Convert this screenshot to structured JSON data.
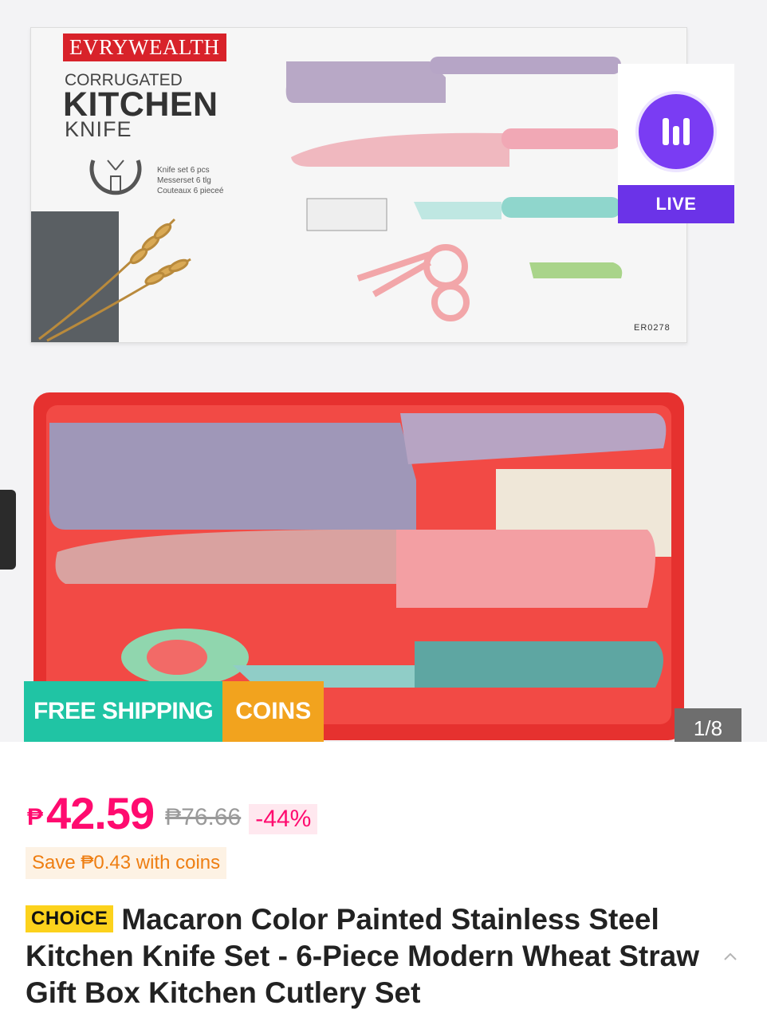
{
  "gallery": {
    "box": {
      "brand": "EVRYWEALTH",
      "subtitle": "CORRUGATED",
      "title": "KITCHEN",
      "title2": "KNIFE",
      "set_lines": [
        "Knife set 6 pcs",
        "Messerset 6 tlg",
        "Couteaux 6 pieceé"
      ],
      "code": "ER0278"
    },
    "live_badge": {
      "label": "LIVE",
      "icon": "live-bars-icon"
    },
    "badges": {
      "free_shipping": "FREE SHIPPING",
      "coins": "COINS"
    },
    "counter": "1/8"
  },
  "price": {
    "currency": "₱",
    "current": "42.59",
    "original": "₱76.66",
    "discount": "-44%"
  },
  "coins_save": "Save ₱0.43 with coins",
  "product": {
    "choice_badge": "CHOiCE",
    "title": "Macaron Color Painted Stainless Steel Kitchen Knife Set - 6-Piece Modern Wheat Straw Gift Box Kitchen Cutlery Set",
    "collapse_icon": "chevron-up-icon"
  },
  "colors": {
    "price": "#ff0b6f",
    "free_shipping": "#20c4a4",
    "coins": "#f2a31e",
    "live": "#6b33e8",
    "choice": "#fcd21c"
  }
}
